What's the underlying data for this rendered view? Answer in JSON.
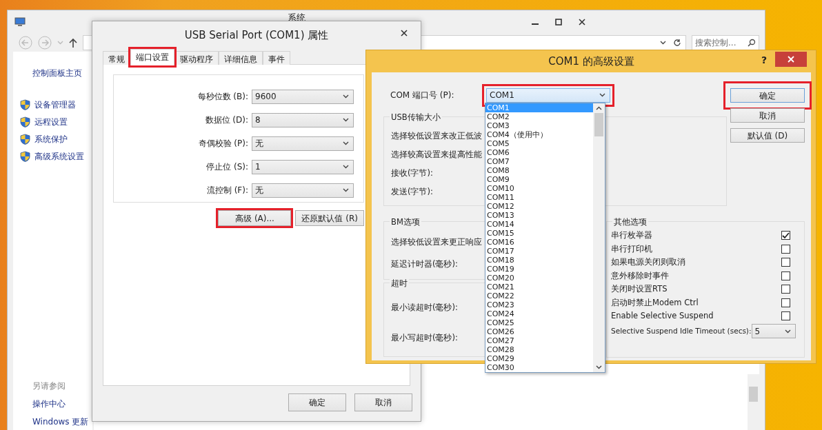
{
  "system_window": {
    "title": "系统",
    "search": {
      "placeholder": "搜索控制..."
    },
    "sidebar": {
      "home": "控制面板主页",
      "items": [
        {
          "label": "设备管理器"
        },
        {
          "label": "远程设置"
        },
        {
          "label": "系统保护"
        },
        {
          "label": "高级系统设置"
        }
      ],
      "see_also": {
        "title": "另请参阅",
        "links": [
          "操作中心",
          "Windows 更新"
        ]
      }
    }
  },
  "properties_dialog": {
    "title": "USB Serial Port (COM1) 属性",
    "tabs": [
      {
        "label": "常规",
        "selected": false,
        "highlighted": false
      },
      {
        "label": "端口设置",
        "selected": true,
        "highlighted": true
      },
      {
        "label": "驱动程序",
        "selected": false,
        "highlighted": false
      },
      {
        "label": "详细信息",
        "selected": false,
        "highlighted": false
      },
      {
        "label": "事件",
        "selected": false,
        "highlighted": false
      }
    ],
    "settings": [
      {
        "label": "每秒位数 (B):",
        "value": "9600"
      },
      {
        "label": "数据位 (D):",
        "value": "8"
      },
      {
        "label": "奇偶校验 (P):",
        "value": "无"
      },
      {
        "label": "停止位 (S):",
        "value": "1"
      },
      {
        "label": "流控制 (F):",
        "value": "无"
      }
    ],
    "buttons": [
      {
        "label": "高级 (A)...",
        "highlighted": true
      },
      {
        "label": "还原默认值 (R)",
        "highlighted": false
      }
    ],
    "footer_buttons": [
      "确定",
      "取消"
    ]
  },
  "advanced_dialog": {
    "title": "COM1 的高级设置",
    "help": "?",
    "com_port": {
      "label": "COM 端口号 (P):",
      "value": "COM1",
      "highlighted": true,
      "expanded": true,
      "options": [
        {
          "label": "COM1",
          "selected": true
        },
        {
          "label": "COM2",
          "selected": false
        },
        {
          "label": "COM3",
          "selected": false
        },
        {
          "label": "COM4（使用中）",
          "selected": false
        },
        {
          "label": "COM5",
          "selected": false
        },
        {
          "label": "COM6",
          "selected": false
        },
        {
          "label": "COM7",
          "selected": false
        },
        {
          "label": "COM8",
          "selected": false
        },
        {
          "label": "COM9",
          "selected": false
        },
        {
          "label": "COM10",
          "selected": false
        },
        {
          "label": "COM11",
          "selected": false
        },
        {
          "label": "COM12",
          "selected": false
        },
        {
          "label": "COM13",
          "selected": false
        },
        {
          "label": "COM14",
          "selected": false
        },
        {
          "label": "COM15",
          "selected": false
        },
        {
          "label": "COM16",
          "selected": false
        },
        {
          "label": "COM17",
          "selected": false
        },
        {
          "label": "COM18",
          "selected": false
        },
        {
          "label": "COM19",
          "selected": false
        },
        {
          "label": "COM20",
          "selected": false
        },
        {
          "label": "COM21",
          "selected": false
        },
        {
          "label": "COM22",
          "selected": false
        },
        {
          "label": "COM23",
          "selected": false
        },
        {
          "label": "COM24",
          "selected": false
        },
        {
          "label": "COM25",
          "selected": false
        },
        {
          "label": "COM26",
          "selected": false
        },
        {
          "label": "COM27",
          "selected": false
        },
        {
          "label": "COM28",
          "selected": false
        },
        {
          "label": "COM29",
          "selected": false
        },
        {
          "label": "COM30",
          "selected": false
        }
      ]
    },
    "usb_group": {
      "title": "USB传输大小",
      "lines": [
        "选择较低设置来改正低波",
        "选择较高设置来提高性能",
        "接收(字节):",
        "发送(字节):"
      ]
    },
    "bm_group": {
      "title": "BM选项",
      "lines": [
        "选择较低设置来更正响应",
        "延迟计时器(毫秒):"
      ]
    },
    "timeout_group": {
      "title": "超时",
      "lines": [
        "最小读超时(毫秒):",
        "最小写超时(毫秒):"
      ]
    },
    "buttons": [
      {
        "label": "确定",
        "highlighted": true
      },
      {
        "label": "取消",
        "highlighted": false
      },
      {
        "label": "默认值 (D)",
        "highlighted": false
      }
    ],
    "other_options": {
      "title": "其他选项",
      "items": [
        {
          "kind": "checkbox",
          "label": "串行枚举器",
          "checked": true
        },
        {
          "kind": "checkbox",
          "label": "串行打印机",
          "checked": false
        },
        {
          "kind": "checkbox",
          "label": "如果电源关闭则取消",
          "checked": false
        },
        {
          "kind": "checkbox",
          "label": "意外移除时事件",
          "checked": false
        },
        {
          "kind": "checkbox",
          "label": "关闭时设置RTS",
          "checked": false
        },
        {
          "kind": "checkbox",
          "label": "启动时禁止Modem Ctrl",
          "checked": false
        },
        {
          "kind": "checkbox",
          "label": "Enable Selective Suspend",
          "checked": false
        },
        {
          "kind": "select",
          "label": "Selective Suspend Idle Timeout (secs):",
          "value": "5"
        }
      ]
    }
  }
}
